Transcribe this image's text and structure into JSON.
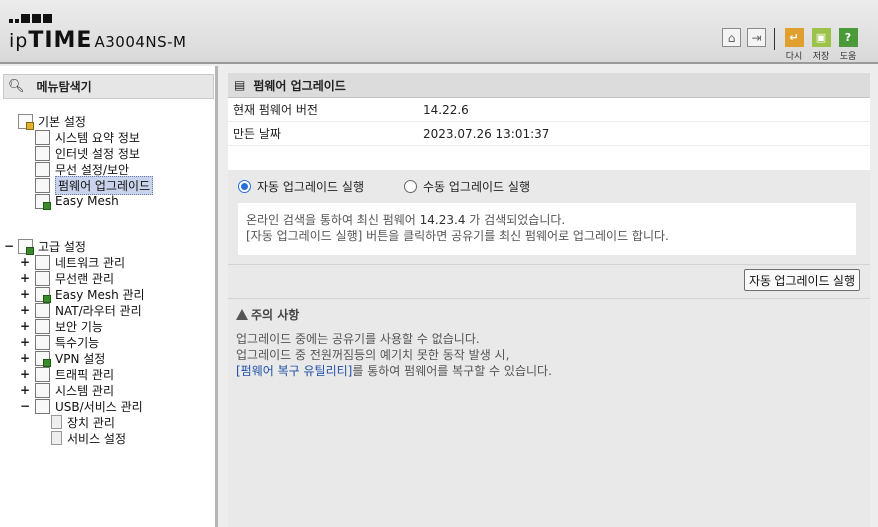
{
  "header": {
    "brand_ip": "ip",
    "brand_time": "TIME",
    "model": "A3004NS-M",
    "buttons": [
      {
        "label": "다시",
        "icon": "refresh-icon",
        "color": "#e0a030"
      },
      {
        "label": "저장",
        "icon": "save-icon",
        "color": "#9cc24a"
      },
      {
        "label": "도움",
        "icon": "help-icon",
        "color": "#4a9a3a"
      }
    ]
  },
  "sidebar": {
    "title": "메뉴탐색기",
    "basic": {
      "label": "기본 설정",
      "items": [
        "시스템 요약 정보",
        "인터넷 설정 정보",
        "무선 설정/보안",
        "펌웨어 업그레이드",
        "Easy Mesh"
      ]
    },
    "advanced": {
      "expander": "−",
      "label": "고급 설정",
      "items": [
        {
          "exp": "+",
          "label": "네트워크 관리"
        },
        {
          "exp": "+",
          "label": "무선랜 관리"
        },
        {
          "exp": "+",
          "label": "Easy Mesh 관리"
        },
        {
          "exp": "+",
          "label": "NAT/라우터 관리"
        },
        {
          "exp": "+",
          "label": "보안 기능"
        },
        {
          "exp": "+",
          "label": "특수기능"
        },
        {
          "exp": "+",
          "label": "VPN 설정"
        },
        {
          "exp": "+",
          "label": "트래픽 관리"
        },
        {
          "exp": "+",
          "label": "시스템 관리"
        },
        {
          "exp": "−",
          "label": "USB/서비스 관리"
        }
      ],
      "usb_children": [
        "장치 관리",
        "서비스 설정"
      ]
    }
  },
  "main": {
    "title": "펌웨어 업그레이드",
    "rows": [
      {
        "key": "현재 펌웨어 버전",
        "value": "14.22.6"
      },
      {
        "key": "만든 날짜",
        "value": "2023.07.26 13:01:37"
      }
    ],
    "options": {
      "auto": "자동 업그레이드 실행",
      "manual": "수동 업그레이드 실행",
      "selected": "auto"
    },
    "message": {
      "line1_pre": "온라인 검색을 통하여 최신 펌웨어",
      "line1_ver": "14.23.4",
      "line1_post": "가 검색되었습니다.",
      "line2": "[자동 업그레이드 실행] 버튼을 클릭하면 공유기를 최신 펌웨어로 업그레이드 합니다."
    },
    "run_button": "자동 업그레이드 실행",
    "notice": {
      "title": "주의 사항",
      "line1": "업그레이드 중에는 공유기를 사용할 수 없습니다.",
      "line2": "업그레이드 중 전원꺼짐등의 예기치 못한 동작 발생 시,",
      "link": "[펌웨어 복구 유틸리티]",
      "line3_post": "를 통하여 펌웨어를 복구할 수 있습니다."
    }
  }
}
